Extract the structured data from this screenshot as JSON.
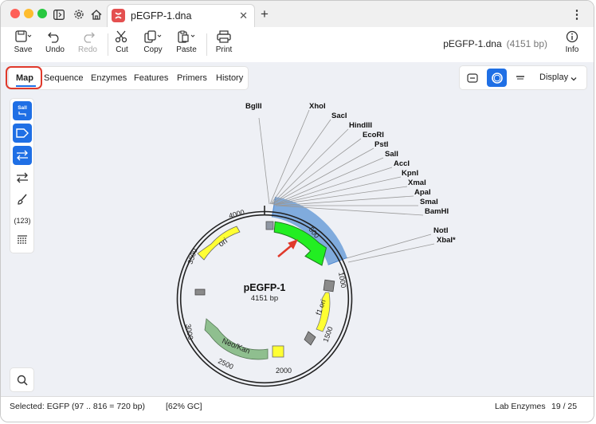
{
  "tab": {
    "filename": "pEGFP-1.dna"
  },
  "toolbar": {
    "items": [
      {
        "label": "Save"
      },
      {
        "label": "Undo"
      },
      {
        "label": "Redo"
      },
      {
        "label": "Cut"
      },
      {
        "label": "Copy"
      },
      {
        "label": "Paste"
      },
      {
        "label": "Print"
      }
    ],
    "file_name": "pEGFP-1.dna",
    "file_size": "(4151 bp)",
    "info_label": "Info"
  },
  "view_tabs": [
    "Map",
    "Sequence",
    "Enzymes",
    "Features",
    "Primers",
    "History"
  ],
  "display_label": "Display",
  "sidebar": {
    "sali_label": "SalI",
    "numbers_label": "(123)"
  },
  "map": {
    "name": "pEGFP-1",
    "length": "4151 bp",
    "enzymes": [
      "BglII",
      "XhoI",
      "SacI",
      "HindIII",
      "EcoRI",
      "PstI",
      "SalI",
      "AccI",
      "KpnI",
      "XmaI",
      "ApaI",
      "SmaI",
      "BamHI",
      "NotI",
      "XbaI*"
    ],
    "ticks": [
      "500",
      "1000",
      "1500",
      "2000",
      "2500",
      "3000",
      "3500",
      "4000"
    ],
    "features": [
      "ori",
      "Neo/Kan",
      "f1 ori"
    ],
    "colors": {
      "egfp": "#22ee22",
      "ori": "#ffff33",
      "neo": "#8fbf8f",
      "selection": "#6c9fd8",
      "accent": "#1f6fe5"
    }
  },
  "status": {
    "selected": "Selected:  EGFP  (97 .. 816  =  720 bp)",
    "gc": "[62% GC]",
    "enzymes": "Lab Enzymes",
    "count": "19 / 25"
  }
}
